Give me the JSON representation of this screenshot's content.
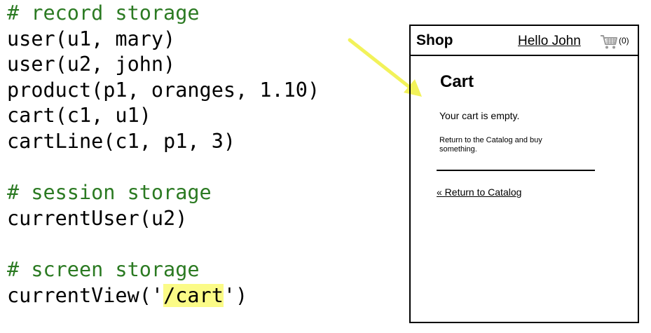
{
  "code": {
    "record_comment": "# record storage",
    "line_user1": "user(u1, mary)",
    "line_user2": "user(u2, john)",
    "line_product": "product(p1, oranges, 1.10)",
    "line_cart": "cart(c1, u1)",
    "line_cartline": "cartLine(c1, p1, 3)",
    "session_comment": "# session storage",
    "line_current_user": "currentUser(u2)",
    "screen_comment": "# screen storage",
    "line_current_view_prefix": "currentView('",
    "line_current_view_value": "/cart",
    "line_current_view_suffix": "')"
  },
  "colors": {
    "comment": "#2b7a22",
    "highlight": "#fbfb87",
    "arrow": "#f2f25a"
  },
  "mockup": {
    "brand": "Shop",
    "greeting": "Hello John",
    "cart_icon": "shopping-cart-icon",
    "cart_count": "(0)",
    "page_title": "Cart",
    "empty_message": "Your cart is empty.",
    "hint": "Return to the Catalog and buy something.",
    "return_link": "« Return to Catalog"
  }
}
